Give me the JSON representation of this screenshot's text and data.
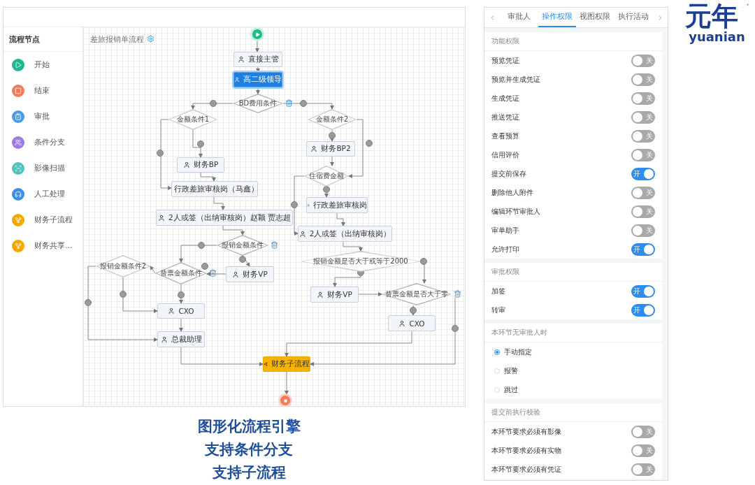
{
  "flow_screen": {
    "sidebar": {
      "title": "流程节点",
      "items": [
        {
          "label": "开始",
          "kind": "start",
          "color": "#1fb98f"
        },
        {
          "label": "结束",
          "kind": "end",
          "color": "#f57a5a"
        },
        {
          "label": "审批",
          "kind": "approve",
          "color": "#4a9be8"
        },
        {
          "label": "条件分支",
          "kind": "branch",
          "color": "#9b7be6"
        },
        {
          "label": "影像扫描",
          "kind": "scan",
          "color": "#4ec3c0"
        },
        {
          "label": "人工处理",
          "kind": "manual",
          "color": "#3b8fe6"
        },
        {
          "label": "财务子流程",
          "kind": "subflow",
          "color": "#f5a800"
        },
        {
          "label": "财务共享...",
          "kind": "subflow",
          "color": "#f5a800"
        }
      ]
    },
    "canvas": {
      "title": "差旅报销单流程",
      "nodes": [
        {
          "kind": "start"
        },
        {
          "kind": "task",
          "label": "直接主管",
          "selected": false
        },
        {
          "kind": "task",
          "label": "高二级领导",
          "selected": true
        },
        {
          "kind": "condition",
          "label": "BD费用条件",
          "delete_icon": true
        },
        {
          "kind": "condition",
          "label": "金额条件1",
          "delete_icon": false
        },
        {
          "kind": "condition",
          "label": "金额条件2",
          "delete_icon": false
        },
        {
          "kind": "task",
          "label": "财务BP2",
          "selected": false
        },
        {
          "kind": "task",
          "label": "财务BP",
          "selected": false
        },
        {
          "kind": "condition",
          "label": "住宿费金额",
          "delete_icon": false
        },
        {
          "kind": "task",
          "label": "行政差旅审核岗（马鑫）",
          "selected": false
        },
        {
          "kind": "task",
          "label": "行政差旅审核岗",
          "selected": false
        },
        {
          "kind": "task",
          "label": "2人或签（出纳审核岗）赵颖 贾志超",
          "selected": false
        },
        {
          "kind": "task",
          "label": "2人或签（出纳审核岗）",
          "selected": false
        },
        {
          "kind": "condition",
          "label": "报销金额条件",
          "delete_icon": true
        },
        {
          "kind": "condition",
          "label": "报销金额是否大于或等于2000",
          "delete_icon": false
        },
        {
          "kind": "condition",
          "label": "报销金额条件2",
          "delete_icon": false
        },
        {
          "kind": "condition",
          "label": "替票金额条件",
          "delete_icon": true
        },
        {
          "kind": "task",
          "label": "财务VP",
          "selected": false
        },
        {
          "kind": "task",
          "label": "财务VP",
          "selected": false
        },
        {
          "kind": "condition",
          "label": "替票金额是否大于零",
          "delete_icon": true
        },
        {
          "kind": "task",
          "label": "CXO",
          "selected": false
        },
        {
          "kind": "task",
          "label": "CXO",
          "selected": false
        },
        {
          "kind": "task",
          "label": "总裁助理",
          "selected": false
        },
        {
          "kind": "subprocess",
          "label": "财务子流程"
        },
        {
          "kind": "end"
        }
      ]
    }
  },
  "settings_panel": {
    "tabs": [
      {
        "label": "审批人",
        "selected": false
      },
      {
        "label": "操作权限",
        "selected": true
      },
      {
        "label": "视图权限",
        "selected": false
      },
      {
        "label": "执行活动",
        "selected": false
      }
    ],
    "sections": [
      {
        "title": "功能权限",
        "kind": "toggles",
        "items": [
          {
            "label": "预览凭证",
            "on": false,
            "toggle_text": "关"
          },
          {
            "label": "预览并生成凭证",
            "on": false,
            "toggle_text": "关"
          },
          {
            "label": "生成凭证",
            "on": false,
            "toggle_text": "关"
          },
          {
            "label": "推送凭证",
            "on": false,
            "toggle_text": "关"
          },
          {
            "label": "查看预算",
            "on": false,
            "toggle_text": "关"
          },
          {
            "label": "信用评价",
            "on": false,
            "toggle_text": "关"
          },
          {
            "label": "提交前保存",
            "on": true,
            "toggle_text": "开"
          },
          {
            "label": "删除他人附件",
            "on": false,
            "toggle_text": "关"
          },
          {
            "label": "编辑环节审批人",
            "on": false,
            "toggle_text": "关"
          },
          {
            "label": "审单助手",
            "on": false,
            "toggle_text": "关"
          },
          {
            "label": "允许打印",
            "on": true,
            "toggle_text": "开"
          }
        ]
      },
      {
        "title": "审批权限",
        "kind": "toggles",
        "items": [
          {
            "label": "加签",
            "on": true,
            "toggle_text": "开"
          },
          {
            "label": "转审",
            "on": true,
            "toggle_text": "开"
          }
        ]
      },
      {
        "title": "本环节无审批人时",
        "kind": "radios",
        "items": [
          {
            "label": "手动指定",
            "selected": true
          },
          {
            "label": "报警",
            "selected": false
          },
          {
            "label": "跳过",
            "selected": false
          }
        ]
      },
      {
        "title": "提交前执行校验",
        "kind": "toggles",
        "items": [
          {
            "label": "本环节要求必须有影像",
            "on": false,
            "toggle_text": "关"
          },
          {
            "label": "本环节要求必须有实物",
            "on": false,
            "toggle_text": "关"
          },
          {
            "label": "本环节要求必须有凭证",
            "on": false,
            "toggle_text": "关"
          }
        ]
      }
    ]
  },
  "caption": [
    "图形化流程引擎",
    "支持条件分支",
    "支持子流程"
  ],
  "logo": {
    "mark": "元年",
    "wordmark": "yuanian"
  }
}
